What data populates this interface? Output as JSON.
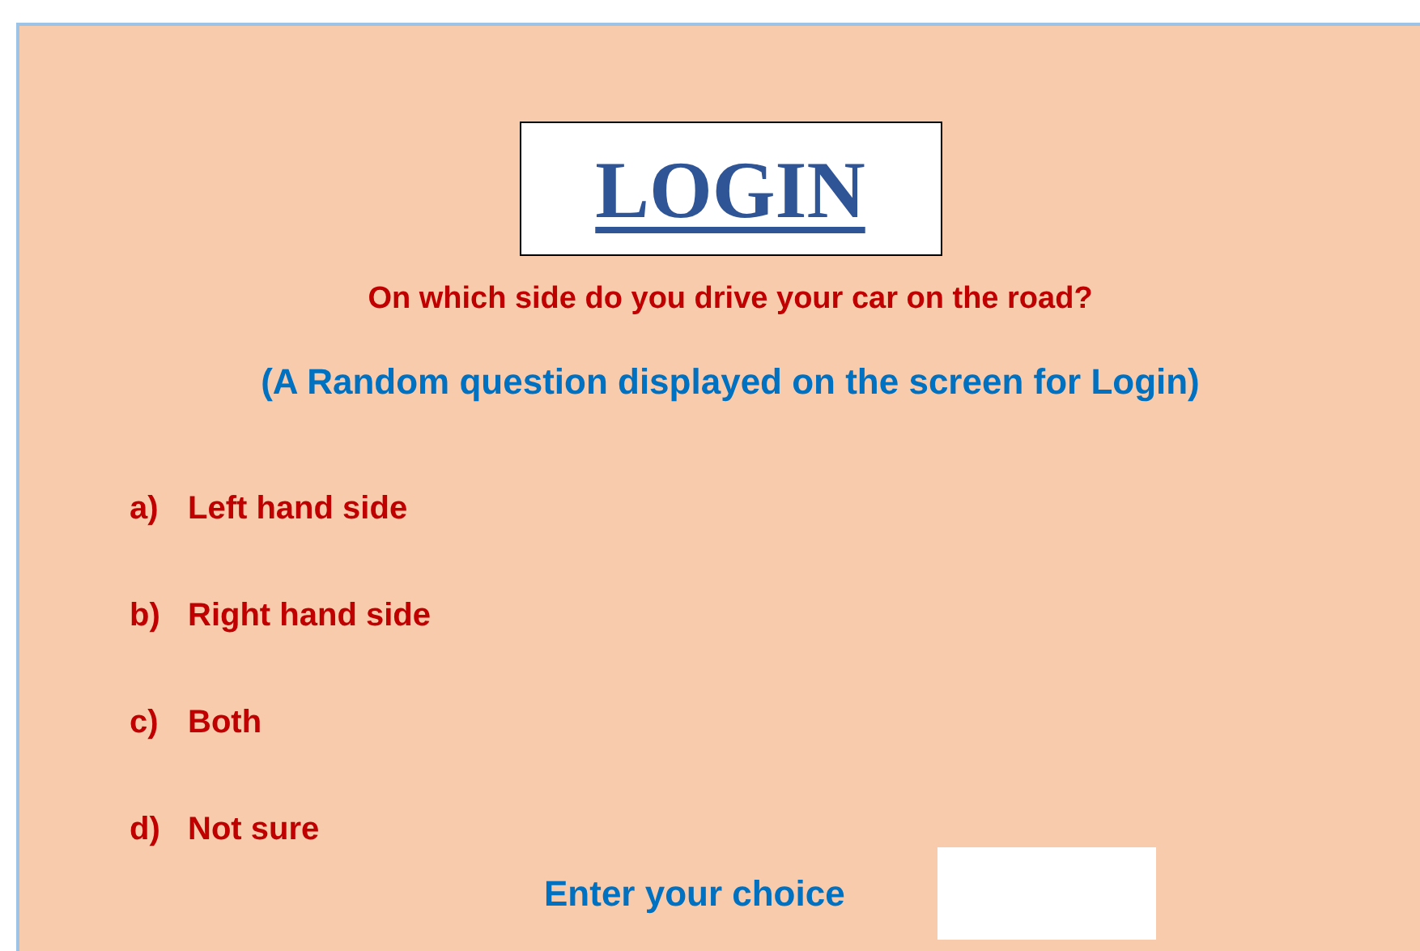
{
  "title": "LOGIN",
  "question": "On which side do you drive your car on the road?",
  "note": "(A Random question displayed on the screen for Login)",
  "options": [
    {
      "letter": "a)",
      "text": "Left hand side"
    },
    {
      "letter": "b)",
      "text": "Right hand side"
    },
    {
      "letter": "c)",
      "text": "Both"
    },
    {
      "letter": "d)",
      "text": "Not sure"
    }
  ],
  "choice": {
    "label": "Enter your choice"
  }
}
